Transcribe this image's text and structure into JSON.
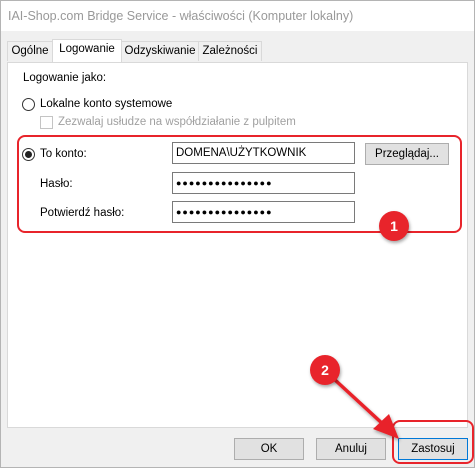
{
  "window": {
    "title": "IAI-Shop.com Bridge Service - właściwości (Komputer lokalny)"
  },
  "tabs": [
    {
      "label": "Ogólne"
    },
    {
      "label": "Logowanie"
    },
    {
      "label": "Odzyskiwanie"
    },
    {
      "label": "Zależności"
    }
  ],
  "logon": {
    "heading": "Logowanie jako:",
    "local_system_label": "Lokalne konto systemowe",
    "desktop_interact_label": "Zezwalaj usłudze na współdziałanie z pulpitem",
    "this_account_label": "To konto:",
    "account_value": "DOMENA\\UŻYTKOWNIK",
    "browse_label": "Przeglądaj...",
    "password_label": "Hasło:",
    "password_value": "●●●●●●●●●●●●●●●",
    "confirm_label": "Potwierdź hasło:",
    "confirm_value": "●●●●●●●●●●●●●●●"
  },
  "buttons": {
    "ok": "OK",
    "cancel": "Anuluj",
    "apply": "Zastosuj"
  },
  "annotations": {
    "badge1": "1",
    "badge2": "2",
    "color": "#e8242b"
  }
}
